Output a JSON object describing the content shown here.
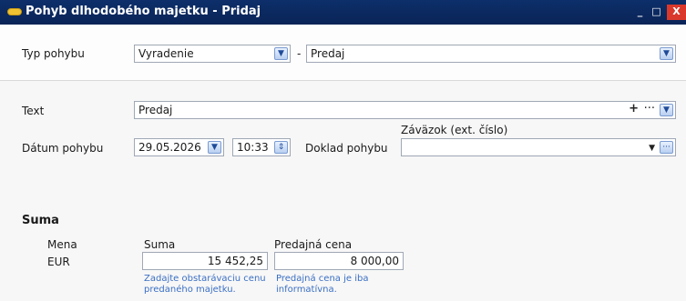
{
  "window": {
    "title": "Pohyb dlhodobého majetku - Pridaj",
    "minimize": "_",
    "maximize": "□",
    "close": "X"
  },
  "type_row": {
    "label": "Typ pohybu",
    "value": "Vyradenie",
    "separator": "-",
    "subtype_value": "Predaj"
  },
  "text_row": {
    "label": "Text",
    "value": "Predaj",
    "add_glyph": "+",
    "more_glyph": "···"
  },
  "date_row": {
    "label": "Dátum pohybu",
    "date_value": "29.05.2026",
    "time_value": "10:33",
    "doc_label": "Doklad pohybu",
    "liability_label": "Záväzok (ext. číslo)",
    "liability_value": "",
    "more_glyph": "···"
  },
  "suma_section": {
    "title": "Suma",
    "currency_header": "Mena",
    "currency_value": "EUR",
    "amount_header": "Suma",
    "amount_value": "15 452,25",
    "amount_hint": "Zadajte obstarávaciu cenu predaného majetku.",
    "sale_header": "Predajná cena",
    "sale_value": "8 000,00",
    "sale_hint": "Predajná cena je iba informatívna."
  }
}
